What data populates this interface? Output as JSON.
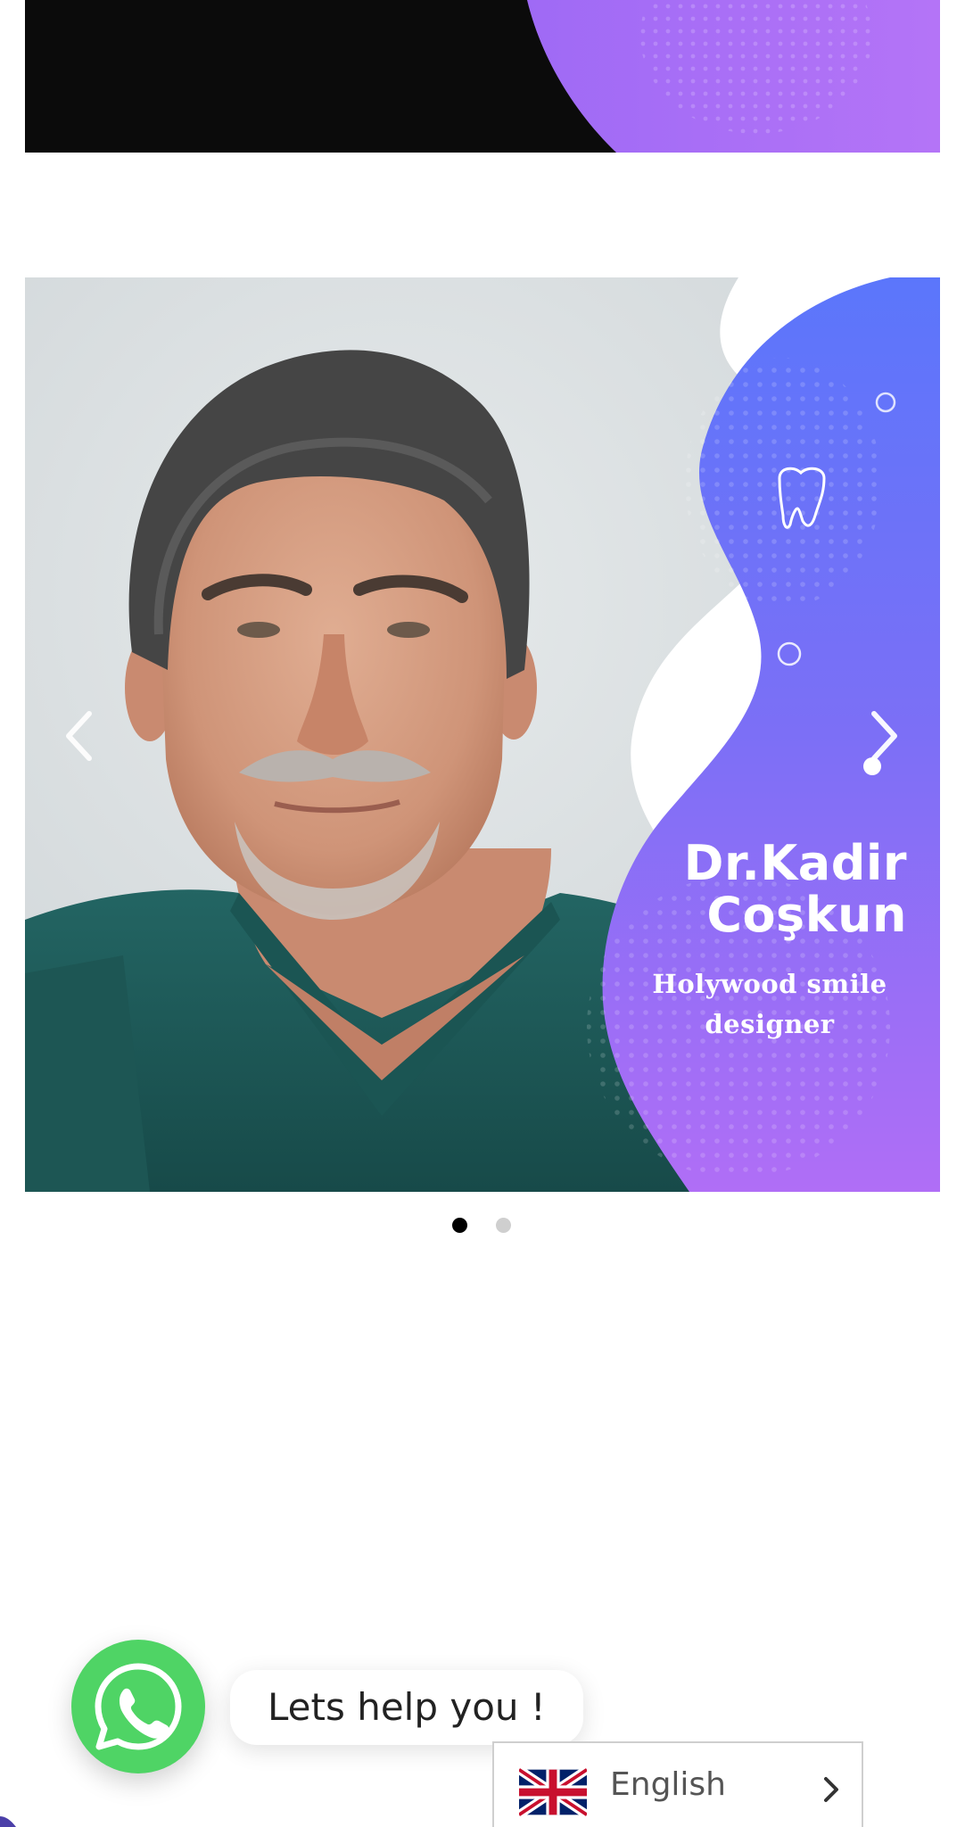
{
  "slider": {
    "doctor_name_line1": "Dr.Kadir",
    "doctor_name_line2": "Coşkun",
    "doctor_title_line1": "Holywood  smile",
    "doctor_title_line2": "designer",
    "active_slide": 1,
    "slide_count": 2
  },
  "whatsapp": {
    "bubble_text": "Lets help you !",
    "icon": "whatsapp-icon",
    "color": "#4fd465"
  },
  "language": {
    "current": "English",
    "flag": "uk-flag-icon"
  },
  "colors": {
    "brand_blue": "#5b76fb",
    "brand_purple": "#b06ef6",
    "scrubs": "#1f5a58"
  }
}
